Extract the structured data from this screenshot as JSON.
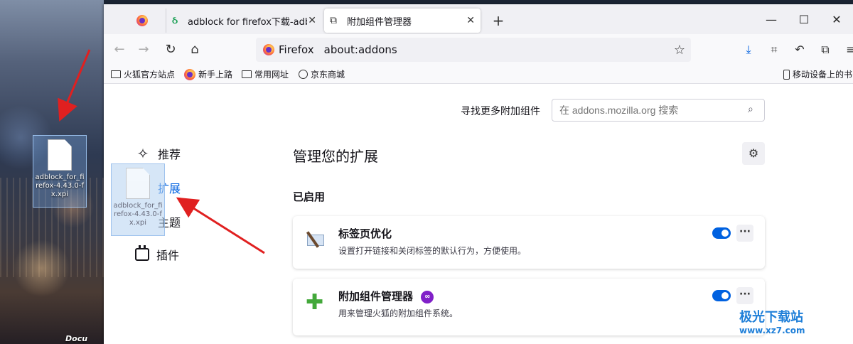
{
  "desktop": {
    "icon_filename": "adblock_for_firefox-4.43.0-fx.xpi",
    "taskbar_label": "Docu"
  },
  "browser": {
    "tabs": [
      {
        "label": ""
      },
      {
        "label": "adblock for firefox下载-adblo",
        "close": "✕"
      },
      {
        "label": "附加组件管理器",
        "close": "✕"
      }
    ],
    "new_tab": "+",
    "window_controls": {
      "minimize": "—",
      "maximize": "☐",
      "close": "✕"
    },
    "url": {
      "identity": "Firefox",
      "address": "about:addons"
    },
    "bookmarks": [
      {
        "label": "火狐官方站点"
      },
      {
        "label": "新手上路"
      },
      {
        "label": "常用网址"
      },
      {
        "label": "京东商城"
      },
      {
        "label": "移动设备上的书"
      }
    ]
  },
  "addons_page": {
    "search_label": "寻找更多附加组件",
    "search_placeholder": "在 addons.mozilla.org 搜索",
    "categories": [
      {
        "label": "推荐"
      },
      {
        "label": "扩展"
      },
      {
        "label": "主题"
      },
      {
        "label": "插件"
      }
    ],
    "heading": "管理您的扩展",
    "enabled_heading": "已启用",
    "addons": [
      {
        "name": "标签页优化",
        "description": "设置打开链接和关闭标签的默认行为，方便使用。",
        "enabled": true
      },
      {
        "name": "附加组件管理器",
        "description": "用来管理火狐的附加组件系统。",
        "enabled": true
      }
    ],
    "more_label": "···"
  },
  "drag_ghost": {
    "filename": "adblock_for_firefox-4.43.0-fx.xpi"
  },
  "watermark": {
    "title": "极光下载站",
    "url": "www.xz7.com"
  },
  "colors": {
    "accent": "#0061e0",
    "arrow": "#e02020",
    "toggle_on": "#0061e0",
    "extension_icon": "#43a83a"
  }
}
